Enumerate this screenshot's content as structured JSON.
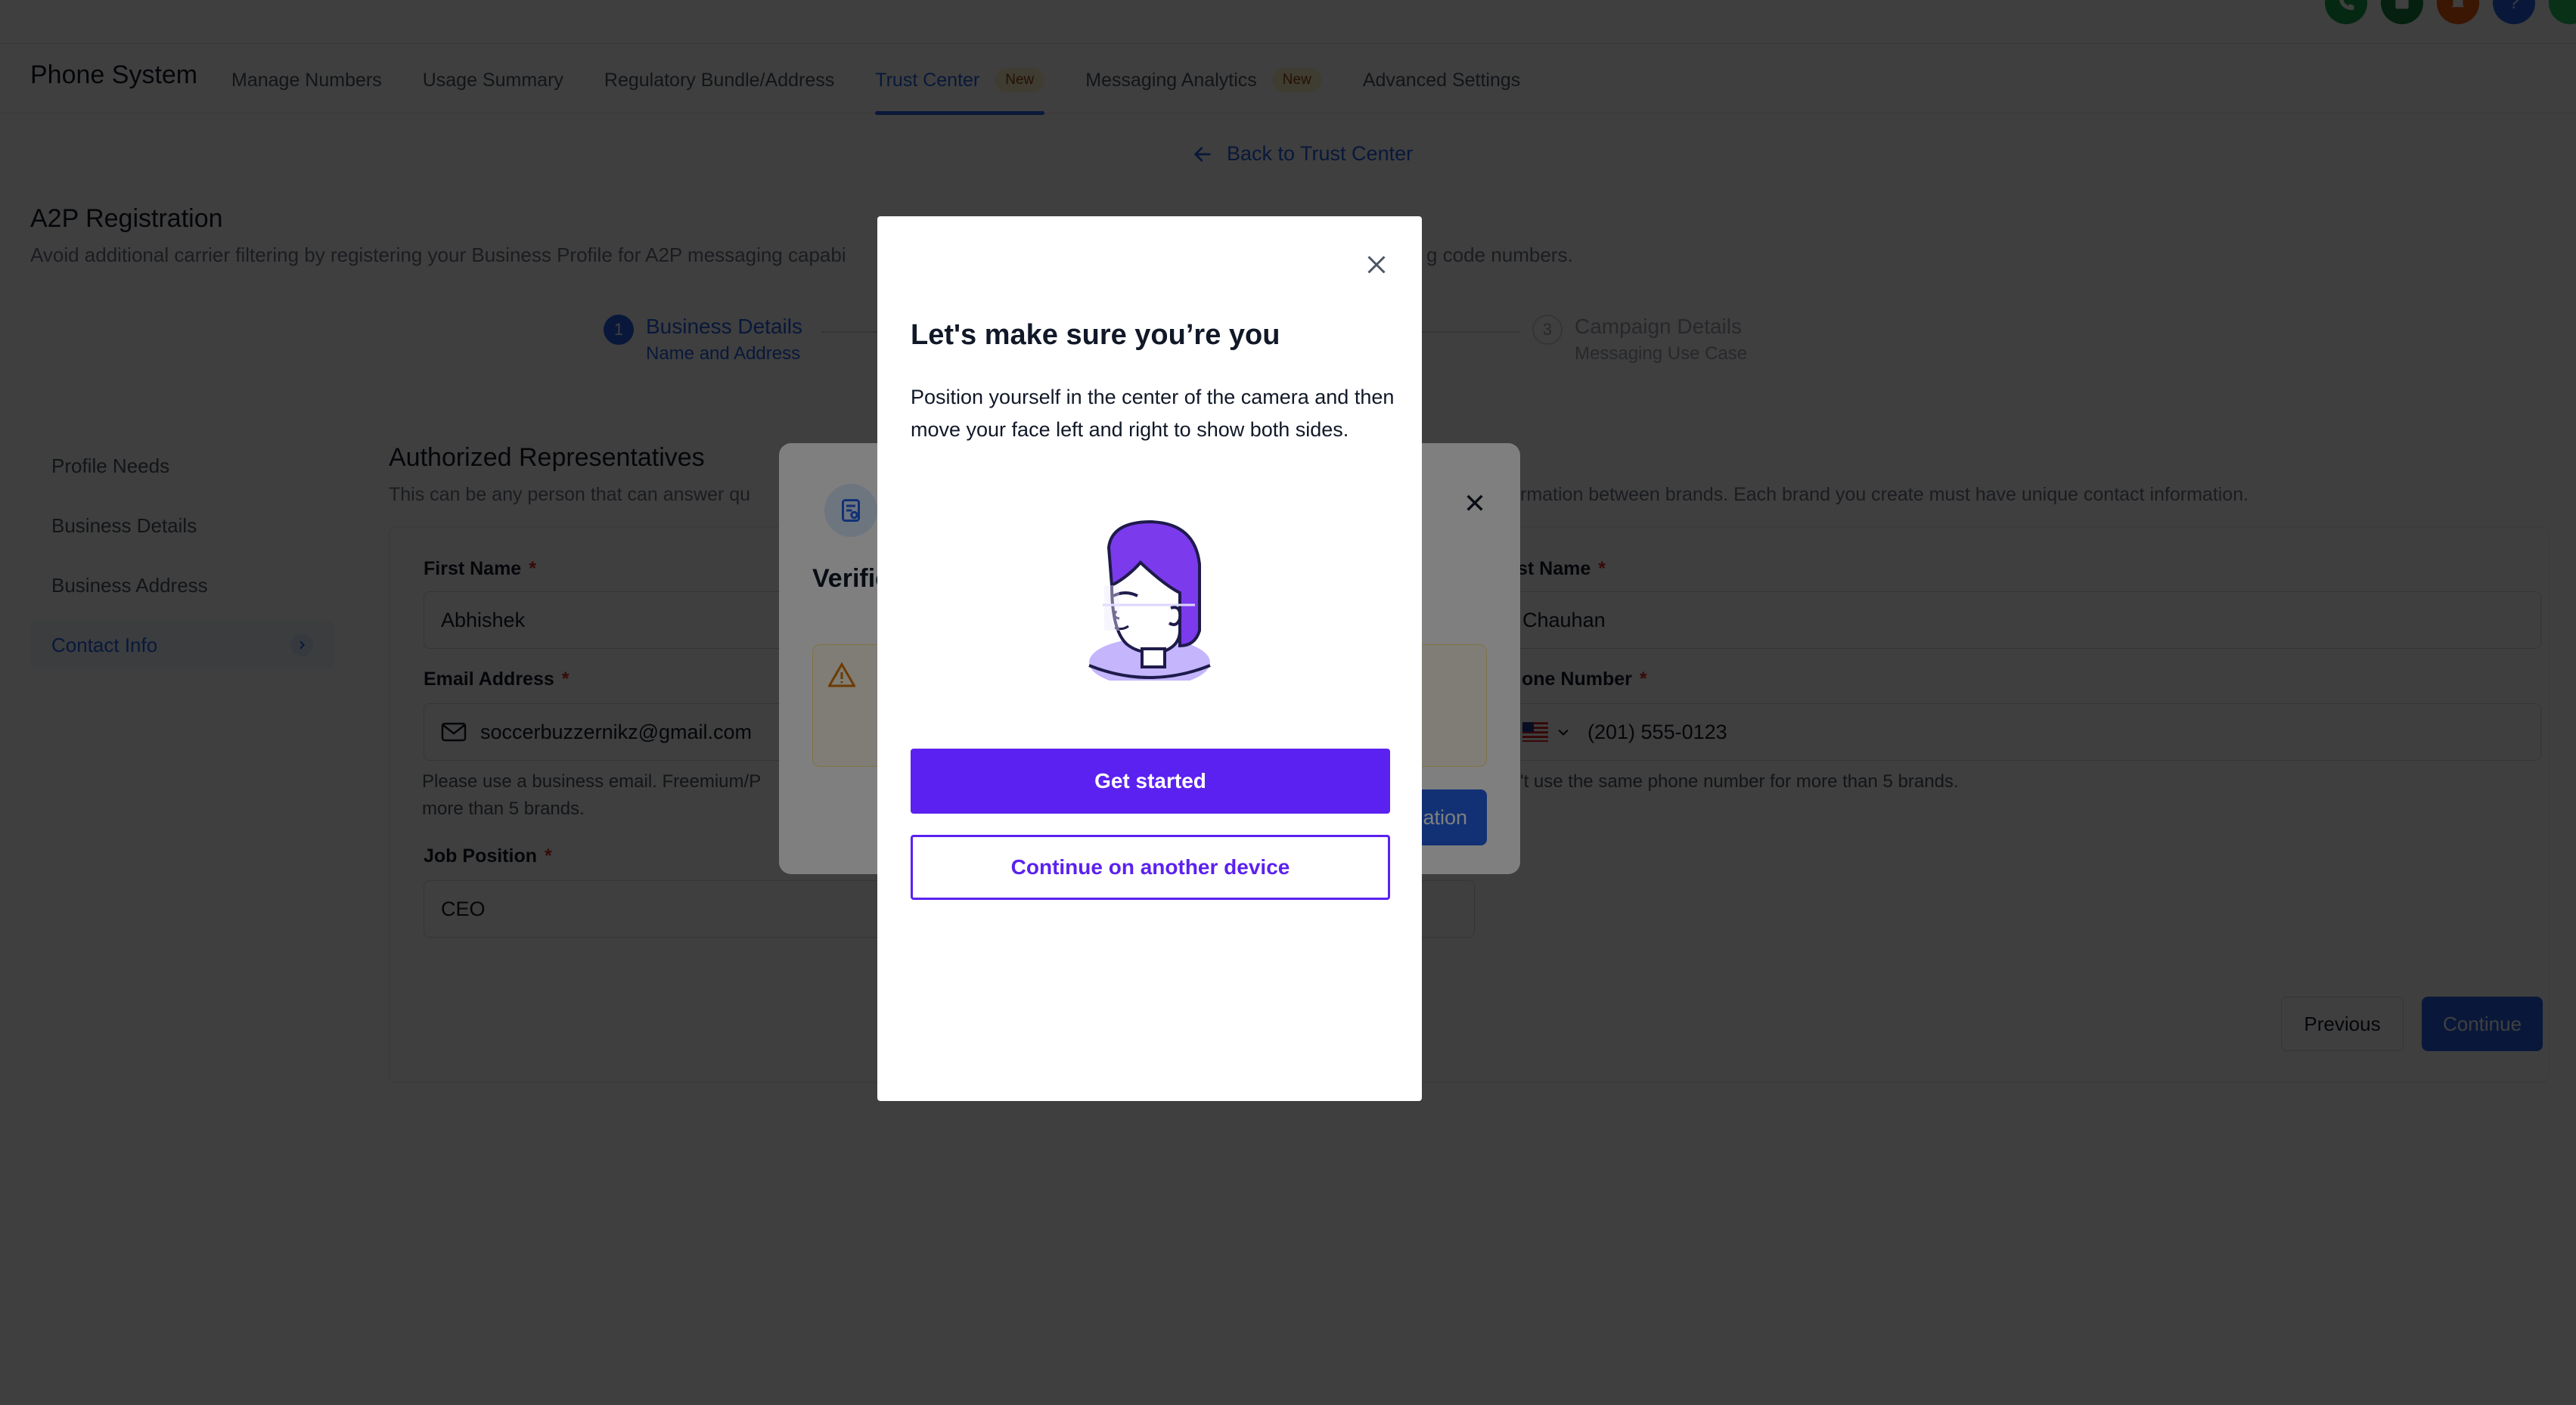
{
  "header": {
    "icons": [
      "phone-icon",
      "news-icon",
      "notification-icon",
      "help-icon",
      "user-avatar"
    ]
  },
  "nav": {
    "app_title": "Phone System",
    "tabs": [
      {
        "label": "Manage Numbers"
      },
      {
        "label": "Usage Summary"
      },
      {
        "label": "Regulatory Bundle/Address"
      },
      {
        "label": "Trust Center",
        "badge": "New",
        "active": true
      },
      {
        "label": "Messaging Analytics",
        "badge": "New"
      },
      {
        "label": "Advanced Settings"
      }
    ],
    "accent_color": "#2563eb"
  },
  "back_link": "Back to Trust Center",
  "page": {
    "heading": "A2P Registration",
    "description": "Avoid additional carrier filtering by registering your Business Profile for A2P messaging capabi",
    "description_tail": "g code numbers."
  },
  "stepper": {
    "steps": [
      {
        "number": "1",
        "title": "Business Details",
        "subtitle": "Name and Address",
        "state": "active"
      },
      {
        "number": "3",
        "title": "Campaign Details",
        "subtitle": "Messaging Use Case",
        "state": "pending"
      }
    ]
  },
  "sidebar": {
    "items": [
      {
        "label": "Profile Needs"
      },
      {
        "label": "Business Details"
      },
      {
        "label": "Business Address"
      },
      {
        "label": "Contact Info",
        "active": true
      }
    ]
  },
  "form": {
    "heading": "Authorized Representatives",
    "description": "This can be any person that can answer qu",
    "description_tail": "rmation between brands. Each brand you create must have unique contact information.",
    "first_name_label": "First Name",
    "first_name_value": "Abhishek",
    "last_name_label": "st Name",
    "last_name_value": "Chauhan",
    "email_label": "Email Address",
    "email_value": "soccerbuzzernikz@gmail.com",
    "email_help_line1": "Please use a business email. Freemium/P",
    "email_help_line2": "more than 5 brands.",
    "phone_label": "one Number",
    "phone_value": "(201) 555-0123",
    "phone_help": "'t use the same phone number for more than 5 brands.",
    "job_label": "Job Position",
    "job_value": "CEO",
    "required_mark": "*",
    "previous_label": "Previous",
    "continue_label": "Continue"
  },
  "underlay_modal": {
    "title": "Verific",
    "alert_icon": "warning-icon",
    "button_label": "ation"
  },
  "modal": {
    "title": "Let's make sure you’re you",
    "body": "Position yourself in the center of the camera and then move your face left and right to show both sides.",
    "primary_label": "Get started",
    "secondary_label": "Continue on another device",
    "brand_color": "#5b21f0"
  }
}
